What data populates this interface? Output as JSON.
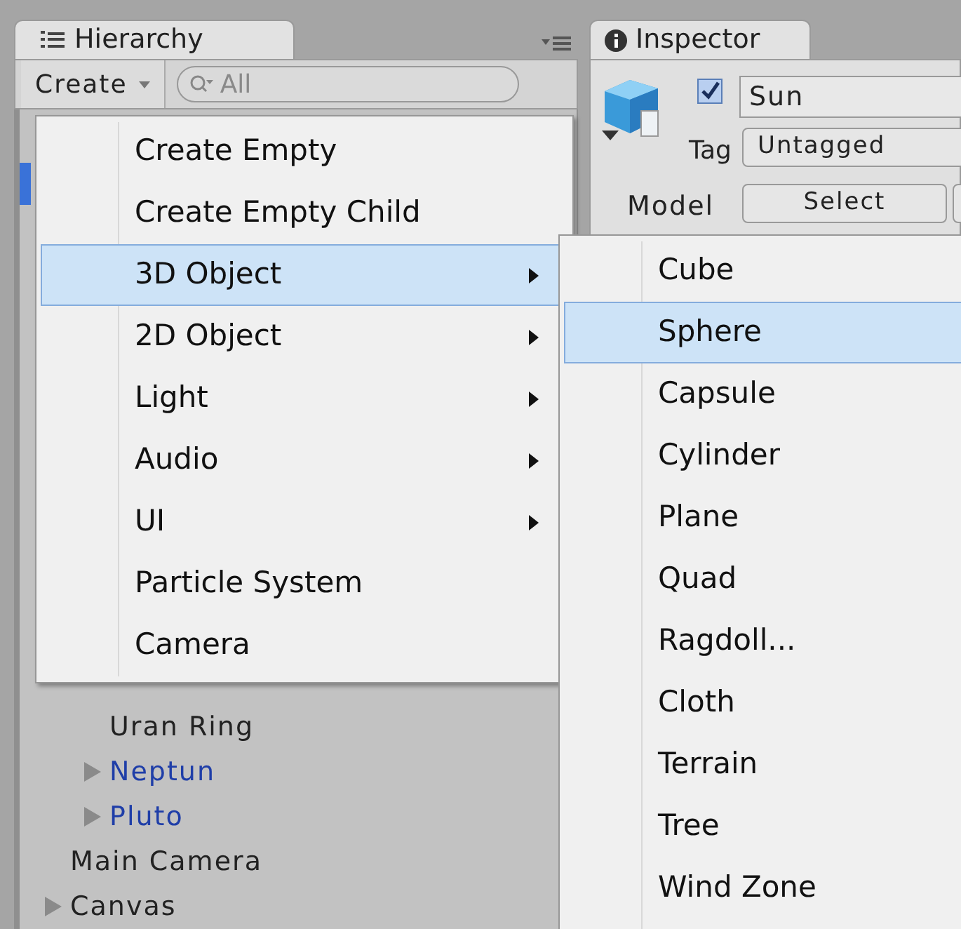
{
  "hierarchy": {
    "tab": "Hierarchy",
    "create_button": "Create",
    "search": {
      "placeholder": "All"
    },
    "nested_items": [
      {
        "label": "Uran Ring",
        "prefab": false,
        "expandable": false
      },
      {
        "label": "Neptun",
        "prefab": true,
        "expandable": true
      },
      {
        "label": "Pluto",
        "prefab": true,
        "expandable": true
      }
    ],
    "root_items": [
      {
        "label": "Main Camera",
        "prefab": false,
        "expandable": false
      },
      {
        "label": "Canvas",
        "prefab": false,
        "expandable": true
      }
    ]
  },
  "inspector": {
    "tab": "Inspector",
    "active": true,
    "name": "Sun",
    "tag_label": "Tag",
    "tag": "Untagged",
    "model_label": "Model",
    "model_button": "Select"
  },
  "create_menu": [
    {
      "label": "Create Empty",
      "submenu": false,
      "selected": false
    },
    {
      "label": "Create Empty Child",
      "submenu": false,
      "selected": false
    },
    {
      "label": "3D Object",
      "submenu": true,
      "selected": true
    },
    {
      "label": "2D Object",
      "submenu": true,
      "selected": false
    },
    {
      "label": "Light",
      "submenu": true,
      "selected": false
    },
    {
      "label": "Audio",
      "submenu": true,
      "selected": false
    },
    {
      "label": "UI",
      "submenu": true,
      "selected": false
    },
    {
      "label": "Particle System",
      "submenu": false,
      "selected": false
    },
    {
      "label": "Camera",
      "submenu": false,
      "selected": false
    }
  ],
  "submenu": [
    {
      "label": "Cube",
      "selected": false
    },
    {
      "label": "Sphere",
      "selected": true
    },
    {
      "label": "Capsule",
      "selected": false
    },
    {
      "label": "Cylinder",
      "selected": false
    },
    {
      "label": "Plane",
      "selected": false
    },
    {
      "label": "Quad",
      "selected": false
    },
    {
      "label": "Ragdoll...",
      "selected": false
    },
    {
      "label": "Cloth",
      "selected": false
    },
    {
      "label": "Terrain",
      "selected": false
    },
    {
      "label": "Tree",
      "selected": false
    },
    {
      "label": "Wind Zone",
      "selected": false
    }
  ]
}
